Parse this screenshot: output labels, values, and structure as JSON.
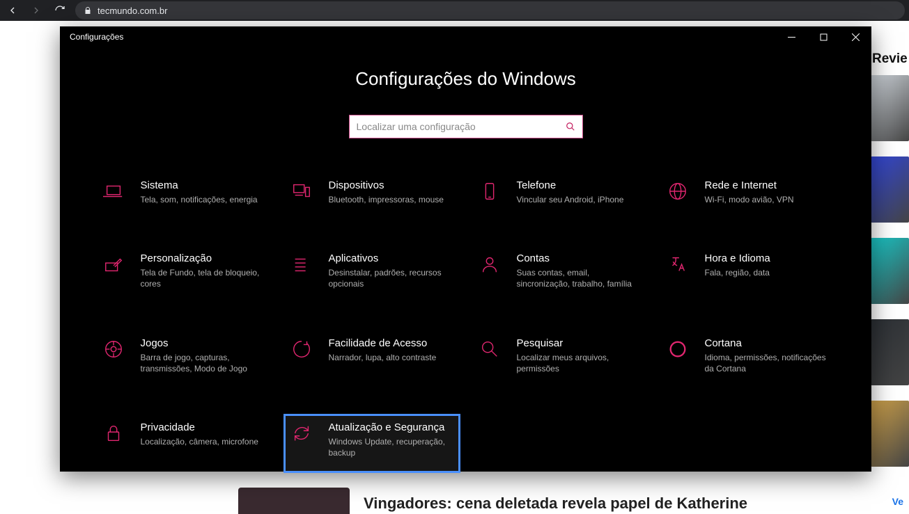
{
  "browser": {
    "url_host": "tecmundo.com.br"
  },
  "background_page": {
    "sidebar_label": "Revie",
    "bottom_headline": "Vingadores: cena deletada revela papel de Katherine",
    "ve_link": "Ve",
    "thumb_colors": [
      "#d0d6dc",
      "#3246d8",
      "#18c9c9",
      "#2b2f34",
      "#cfa24a"
    ]
  },
  "window": {
    "title": "Configurações",
    "heading": "Configurações do Windows",
    "search_placeholder": "Localizar uma configuração",
    "items": [
      {
        "id": "sistema",
        "icon": "laptop",
        "title": "Sistema",
        "sub": "Tela, som, notificações, energia"
      },
      {
        "id": "dispositivos",
        "icon": "devices",
        "title": "Dispositivos",
        "sub": "Bluetooth, impressoras, mouse"
      },
      {
        "id": "telefone",
        "icon": "phone",
        "title": "Telefone",
        "sub": "Vincular seu Android, iPhone"
      },
      {
        "id": "rede",
        "icon": "globe",
        "title": "Rede e Internet",
        "sub": "Wi-Fi, modo avião, VPN"
      },
      {
        "id": "personalizacao",
        "icon": "pen",
        "title": "Personalização",
        "sub": "Tela de Fundo, tela de bloqueio, cores"
      },
      {
        "id": "aplicativos",
        "icon": "apps",
        "title": "Aplicativos",
        "sub": "Desinstalar, padrões, recursos opcionais"
      },
      {
        "id": "contas",
        "icon": "person",
        "title": "Contas",
        "sub": "Suas contas, email, sincronização, trabalho, família"
      },
      {
        "id": "hora",
        "icon": "time-lang",
        "title": "Hora e Idioma",
        "sub": "Fala, região, data"
      },
      {
        "id": "jogos",
        "icon": "gaming",
        "title": "Jogos",
        "sub": "Barra de jogo, capturas, transmissões, Modo de Jogo"
      },
      {
        "id": "acessibilidade",
        "icon": "ease",
        "title": "Facilidade de Acesso",
        "sub": "Narrador, lupa, alto contraste"
      },
      {
        "id": "pesquisar",
        "icon": "search",
        "title": "Pesquisar",
        "sub": "Localizar meus arquivos, permissões"
      },
      {
        "id": "cortana",
        "icon": "cortana",
        "title": "Cortana",
        "sub": "Idioma, permissões, notificações da Cortana"
      },
      {
        "id": "privacidade",
        "icon": "lock",
        "title": "Privacidade",
        "sub": "Localização, câmera, microfone"
      },
      {
        "id": "atualizacao",
        "icon": "update",
        "title": "Atualização e Segurança",
        "sub": "Windows Update, recuperação, backup",
        "highlighted": true
      }
    ]
  }
}
